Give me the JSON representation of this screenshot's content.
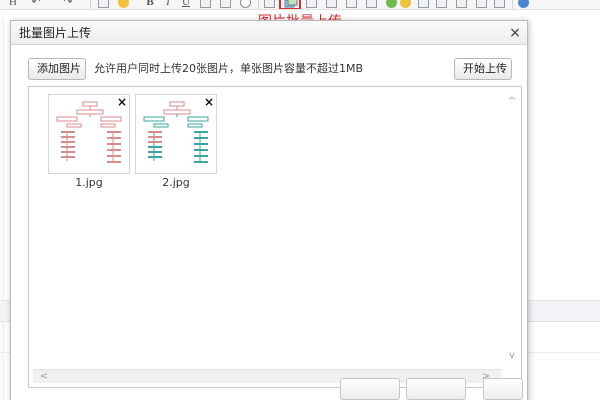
{
  "toolbar": {
    "heading_label": "H",
    "undo_label": "↶",
    "redo_label": "↷",
    "bold_label": "B",
    "italic_label": "I",
    "underline_label": "U",
    "highlight_color": "#d9302c",
    "callout_text": "图片批量上传"
  },
  "dialog": {
    "title": "批量图片上传",
    "close_label": "×",
    "add_button_label": "添加图片",
    "hint_text": "允许用户同时上传20张图片，单张图片容量不超过1MB",
    "start_button_label": "开始上传",
    "files": [
      {
        "name": "1.jpg",
        "remove_label": "×",
        "accent": "#d98c8c"
      },
      {
        "name": "2.jpg",
        "remove_label": "×",
        "accent": "#3aa6a0"
      }
    ],
    "scroll": {
      "up": "^",
      "down": "v",
      "left": "<",
      "right": ">"
    }
  }
}
